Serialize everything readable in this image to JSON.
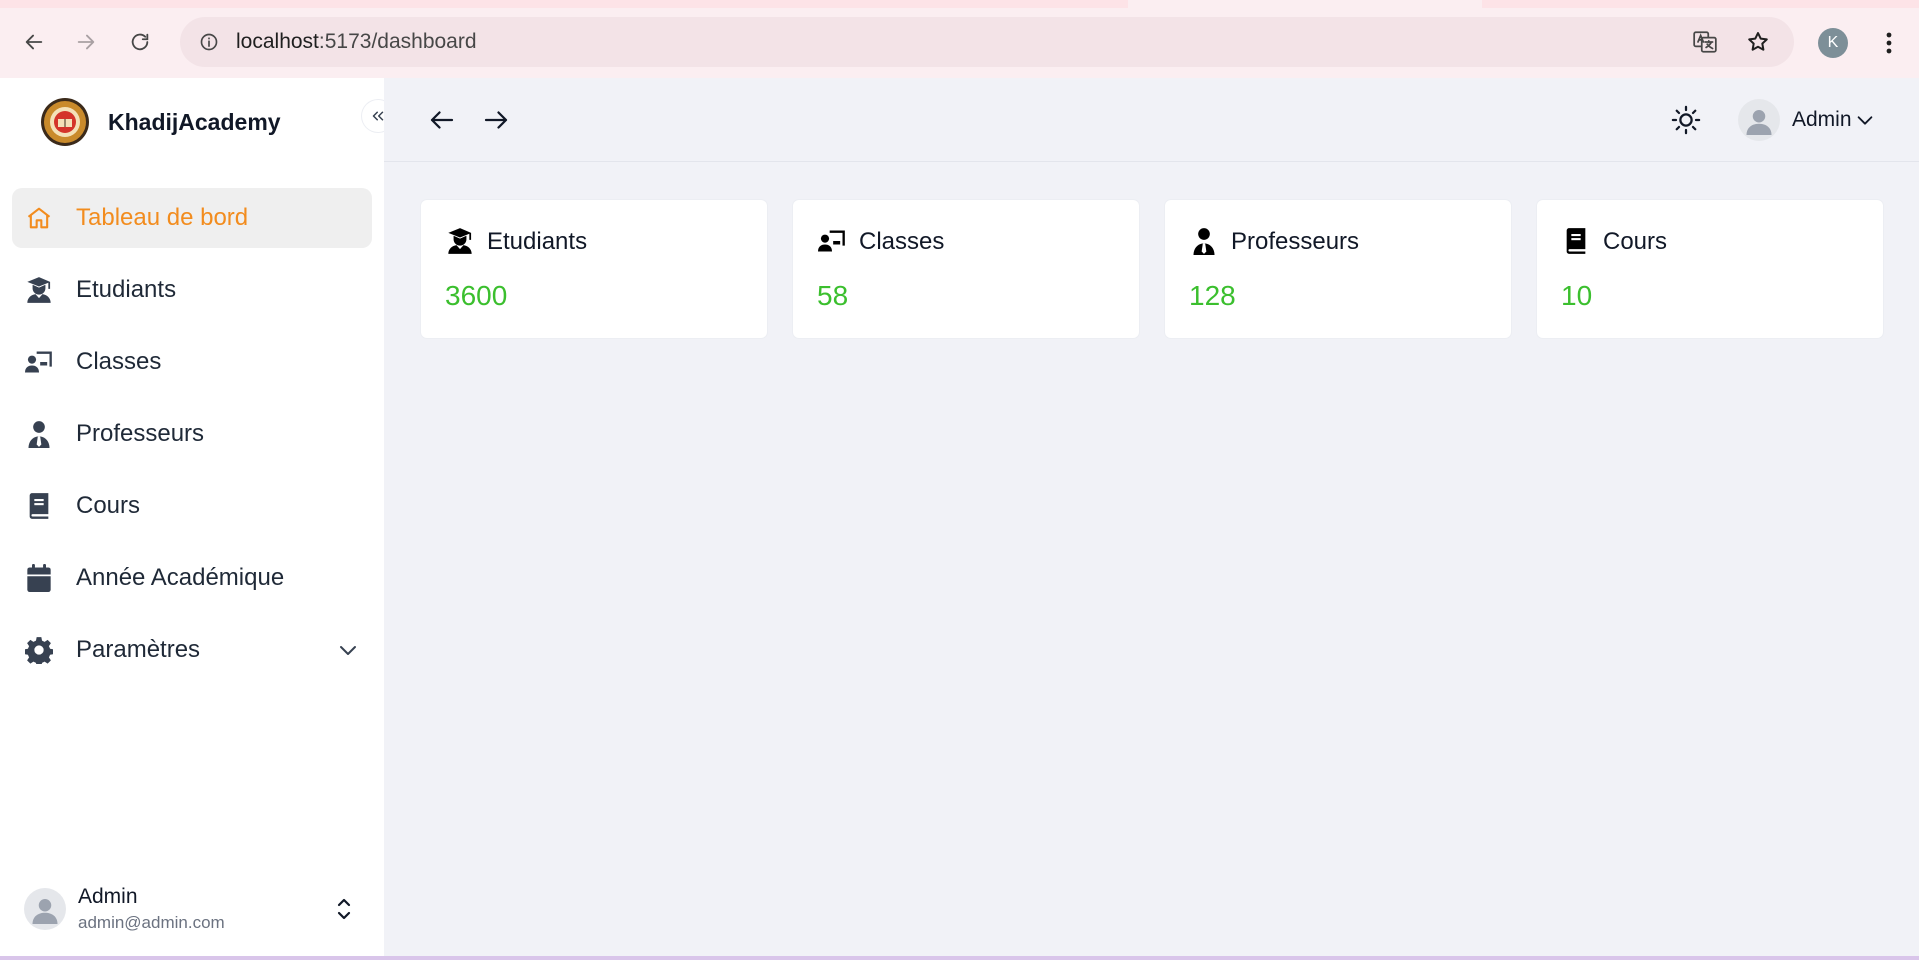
{
  "browser": {
    "url_host": "localhost",
    "url_path": ":5173/dashboard",
    "profile_initial": "K"
  },
  "brand": {
    "name": "KhadijAcademy",
    "logo_icon": "academy-seal-logo"
  },
  "sidebar": {
    "items": [
      {
        "label": "Tableau de bord",
        "icon": "home-icon",
        "active": true
      },
      {
        "label": "Etudiants",
        "icon": "graduate-icon"
      },
      {
        "label": "Classes",
        "icon": "classroom-icon"
      },
      {
        "label": "Professeurs",
        "icon": "teacher-icon"
      },
      {
        "label": "Cours",
        "icon": "book-icon"
      },
      {
        "label": "Année Académique",
        "icon": "calendar-icon"
      },
      {
        "label": "Paramètres",
        "icon": "gear-icon",
        "expandable": true
      }
    ],
    "user": {
      "name": "Admin",
      "email": "admin@admin.com"
    }
  },
  "topbar": {
    "user_label": "Admin"
  },
  "stats": [
    {
      "title": "Etudiants",
      "value": "3600",
      "icon": "graduate-icon"
    },
    {
      "title": "Classes",
      "value": "58",
      "icon": "classroom-icon"
    },
    {
      "title": "Professeurs",
      "value": "128",
      "icon": "teacher-icon"
    },
    {
      "title": "Cours",
      "value": "10",
      "icon": "book-icon"
    }
  ],
  "colors": {
    "accent": "#f28c1e",
    "stat_value": "#3bbf2e",
    "main_bg": "#f1f2f7",
    "sidebar_text": "#1f2937"
  }
}
